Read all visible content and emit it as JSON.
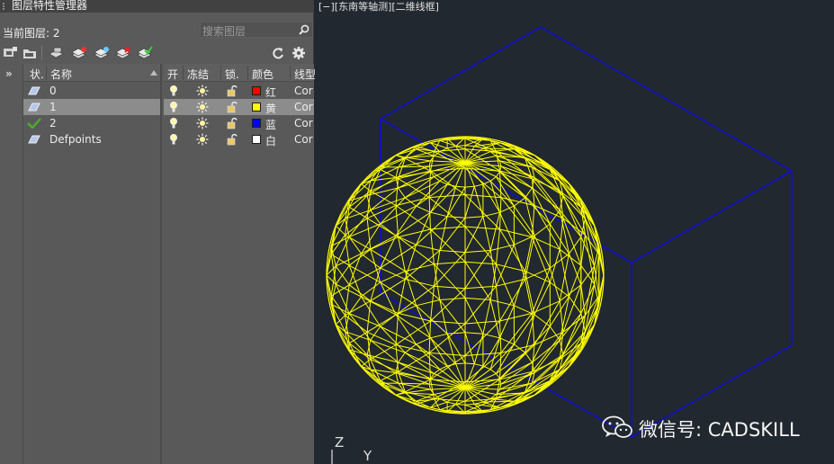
{
  "panel": {
    "title": "图层特性管理器",
    "current_layer_label": "当前图层: 2",
    "search_placeholder": "搜索图层",
    "toolbar_icons": [
      "new-property-filter-icon",
      "new-group-filter-icon",
      "layer-states-manager-icon",
      "new-layer-icon",
      "new-layer-vp-frozen-icon",
      "delete-layer-icon",
      "set-current-icon",
      "refresh-icon",
      "settings-icon"
    ]
  },
  "columns": {
    "status": "状.",
    "name": "名称",
    "on": "开",
    "freeze": "冻结",
    "lock": "锁.",
    "color": "颜色",
    "linetype": "线型"
  },
  "layers": [
    {
      "status": "layer-icon",
      "name": "0",
      "on": true,
      "frozen": false,
      "locked": false,
      "color_name": "红",
      "color_hex": "#ff0000",
      "linetype": "Continuous",
      "linetype_visible": "Cor",
      "selected": false
    },
    {
      "status": "layer-icon",
      "name": "1",
      "on": true,
      "frozen": false,
      "locked": false,
      "color_name": "黄",
      "color_hex": "#ffff00",
      "linetype": "Continuous",
      "linetype_visible": "Cor",
      "selected": true
    },
    {
      "status": "current-check-icon",
      "name": "2",
      "on": true,
      "frozen": false,
      "locked": false,
      "color_name": "蓝",
      "color_hex": "#0000ff",
      "linetype": "Continuous",
      "linetype_visible": "Cor",
      "selected": false
    },
    {
      "status": "layer-icon",
      "name": "Defpoints",
      "on": true,
      "frozen": false,
      "locked": false,
      "color_name": "白",
      "color_hex": "#ffffff",
      "linetype": "Continuous",
      "linetype_visible": "Cor",
      "selected": false
    }
  ],
  "viewport": {
    "label": "[−][东南等轴测][二维线框]",
    "axis_z": "Z",
    "axis_y": "Y",
    "sphere_color": "#ffff00",
    "box_color": "#1010c8",
    "background": "#212830"
  },
  "watermark": {
    "text": "微信号: CADSKILL"
  },
  "colors": {
    "panel_bg": "#5a5a5a",
    "selected_row": "#8c8c8c",
    "current_check": "#4caf2a"
  }
}
